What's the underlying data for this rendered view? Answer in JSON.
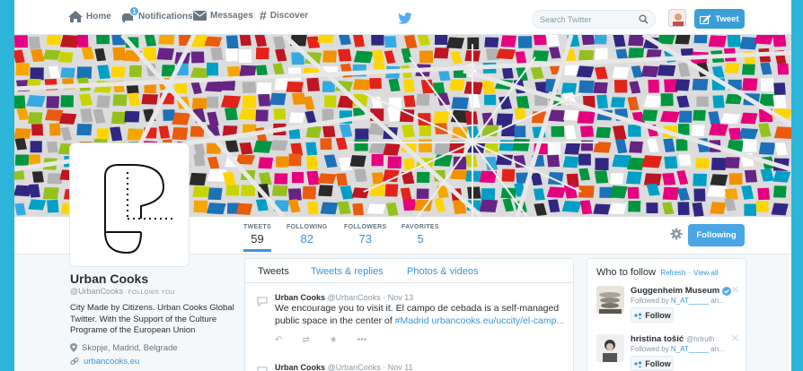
{
  "nav": {
    "home": "Home",
    "notifications": "Notifications",
    "notifications_badge": "1",
    "messages": "Messages",
    "discover": "Discover",
    "search_placeholder": "Search Twitter",
    "tweet_button": "Tweet"
  },
  "stats": [
    {
      "label": "TWEETS",
      "value": "59"
    },
    {
      "label": "FOLLOWING",
      "value": "82"
    },
    {
      "label": "FOLLOWERS",
      "value": "73"
    },
    {
      "label": "FAVORITES",
      "value": "5"
    }
  ],
  "following_button": "Following",
  "profile": {
    "name": "Urban Cooks",
    "handle": "@UrbanCooks",
    "follows_you": "FOLLOWS YOU",
    "bio": "City Made by Citizens. Urban Cooks Global Twitter. With the Support of the Culture Programe of the European Union",
    "location": "Skopje, Madrid, Belgrade",
    "url": "urbancooks.eu"
  },
  "tabs": [
    "Tweets",
    "Tweets & replies",
    "Photos & videos"
  ],
  "tweets": [
    {
      "name": "Urban Cooks",
      "handle": "@UrbanCooks",
      "date": "· Nov 13",
      "text": "We encourage you to visit it. El campo de cebada is a self-managed public space in the center of ",
      "link": "#Madrid urbancooks.eu/uccity/el-camp..."
    },
    {
      "name": "Urban Cooks",
      "handle": "@UrbanCooks",
      "date": "· Nov 11"
    }
  ],
  "who_to_follow": {
    "title": "Who to follow",
    "refresh": "Refresh",
    "separator": "·",
    "view_all": "View all",
    "follow_label": "Follow",
    "items": [
      {
        "name": "Guggenheim Museum",
        "handle": "",
        "followed_by": "Followed by",
        "followed_user": "N_AT_____",
        "followed_rest": "an..."
      },
      {
        "name": "hristina tošić",
        "handle": "@hrtruth",
        "followed_by": "Followed by",
        "followed_user": "N_AT_____",
        "followed_rest": "an..."
      }
    ]
  },
  "colors": {
    "accent": "#3b94d9",
    "follow_button": "#4aa5e4",
    "background": "#2bb5d8"
  }
}
